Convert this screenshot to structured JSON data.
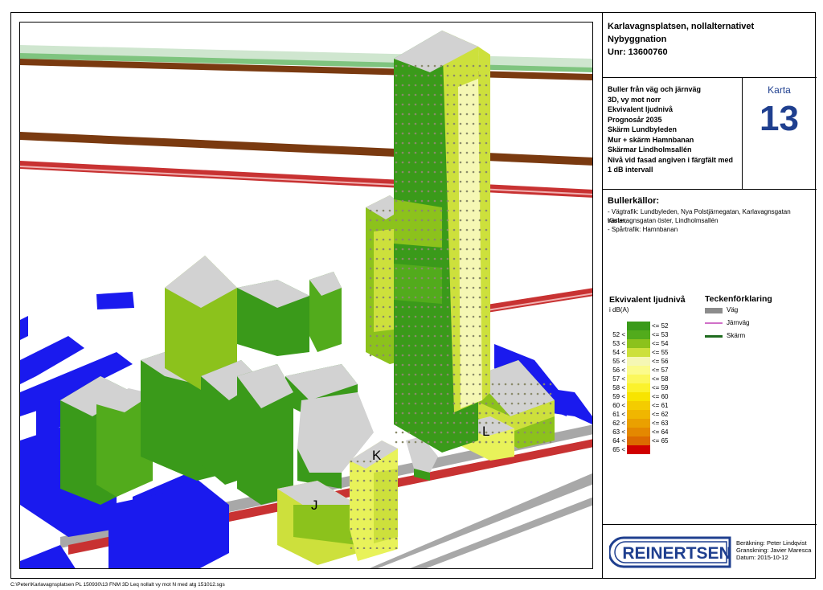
{
  "title": {
    "line1": "Karlavagnsplatsen, nollalternativet",
    "line2": "Nybyggnation",
    "line3": "Unr: 13600760"
  },
  "description": [
    "Buller från väg och järnväg",
    "3D, vy mot norr",
    "Ekvivalent ljudnivå",
    "Prognosår 2035",
    "Skärm Lundbyleden",
    "Mur + skärm Hamnbanan",
    "Skärmar Lindholmsallén",
    "Nivå vid fasad angiven i färgfält med",
    "1 dB intervall"
  ],
  "karta": {
    "label": "Karta",
    "number": "13"
  },
  "sources": {
    "title": "Bullerkällor:",
    "lines": [
      "- Vägtrafik: Lundbyleden, Nya Polstjärnegatan, Karlavagnsgatan väster,",
      "Karlavagnsgatan öster, Lindholmsallén",
      "- Spårtrafik: Hamnbanan"
    ]
  },
  "legend": {
    "title": "Ekvivalent ljudnivå",
    "unit": "i dB(A)",
    "items": [
      {
        "low": "",
        "high": "<= 52",
        "color": "#3a9a1a"
      },
      {
        "low": "52 <",
        "high": "<= 53",
        "color": "#52ab1c"
      },
      {
        "low": "53 <",
        "high": "<= 54",
        "color": "#8cc21c"
      },
      {
        "low": "54 <",
        "high": "<= 55",
        "color": "#cde03c"
      },
      {
        "low": "55 <",
        "high": "<= 56",
        "color": "#f5f7b4"
      },
      {
        "low": "56 <",
        "high": "<= 57",
        "color": "#fbfb8c"
      },
      {
        "low": "57 <",
        "high": "<= 58",
        "color": "#fbf75c"
      },
      {
        "low": "58 <",
        "high": "<= 59",
        "color": "#fbf22c"
      },
      {
        "low": "59 <",
        "high": "<= 60",
        "color": "#f8e400"
      },
      {
        "low": "60 <",
        "high": "<= 61",
        "color": "#f4cc00"
      },
      {
        "low": "61 <",
        "high": "<= 62",
        "color": "#f0b600"
      },
      {
        "low": "62 <",
        "high": "<= 63",
        "color": "#eaa000"
      },
      {
        "low": "63 <",
        "high": "<= 64",
        "color": "#e48800"
      },
      {
        "low": "64 <",
        "high": "<= 65",
        "color": "#dc6a00"
      },
      {
        "low": "65 <",
        "high": "",
        "color": "#d00000"
      }
    ]
  },
  "key": {
    "title": "Teckenförklaring",
    "items": [
      {
        "label": "Väg",
        "color": "#8c8c8c"
      },
      {
        "label": "Järnväg",
        "color": "#d070c8"
      },
      {
        "label": "Skärm",
        "color": "#1f6b1f"
      }
    ]
  },
  "logo": {
    "text": "REINERTSEN",
    "color": "#1f3f8f"
  },
  "credits": [
    "Beräkning: Peter Lindqvist",
    "Granskning: Javier Maresca",
    "Datum: 2015-10-12"
  ],
  "map": {
    "labels": {
      "J": "J",
      "K": "K",
      "L": "L"
    },
    "colors": {
      "existing_building": "#1a1aee",
      "roof": "#d2d2d2",
      "road_red": "#c83232",
      "road_brown": "#7a3a10",
      "road_grey": "#a8a8a8",
      "noise_green": "#3a9a1a",
      "noise_yellow": "#e8f25a"
    }
  },
  "file_path": "C:\\Peter\\Karlavagnsplatsen PL 150930\\13 FNM 3D Leq nollalt vy mot N med atg 151012.sgs"
}
